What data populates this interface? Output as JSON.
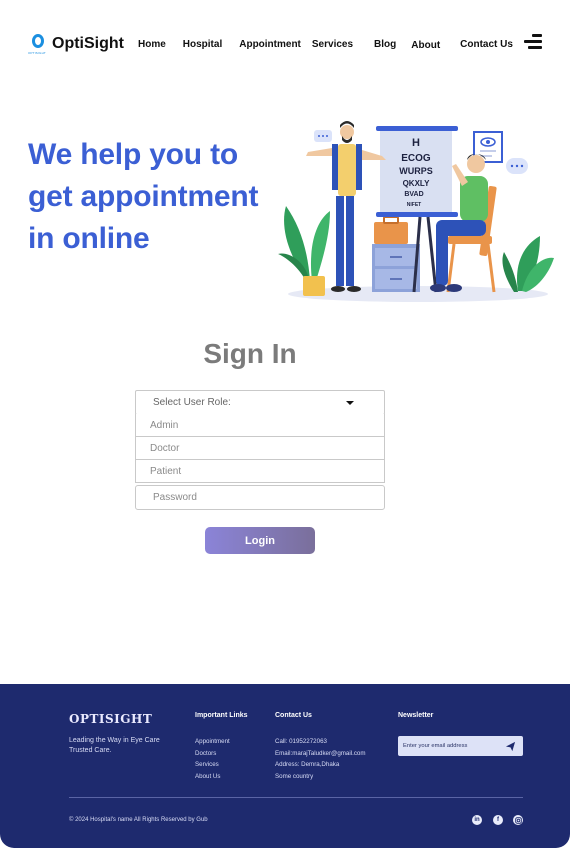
{
  "brand": {
    "logo_text": "OptiSight",
    "logo_small": "OPTISIGHT"
  },
  "nav": {
    "links": [
      "Home",
      "Hospital",
      "Appointment",
      "Services",
      "Blog",
      "About",
      "Contact Us"
    ]
  },
  "hero": {
    "title_line1": "We  help you  to",
    "title_line2": "get appointment",
    "title_line3": "in online",
    "eye_chart": [
      "H",
      "ECOG",
      "WURPS",
      "QKXLY",
      "BVAD",
      "NIFET"
    ]
  },
  "signin": {
    "title": "Sign In",
    "select_placeholder": "Select  User Role:",
    "options": [
      "Admin",
      "Doctor",
      "Patient"
    ],
    "password_placeholder": "Password",
    "login_label": "Login"
  },
  "footer": {
    "brand": "OPTISIGHT",
    "tagline": "Leading the Way in Eye Care Trusted Care.",
    "links_title": "Important Links",
    "links": [
      "Appointment",
      "Doctors",
      "Services",
      "About Us"
    ],
    "contact_title": "Contact Us",
    "contact": [
      "Call: 01952272063",
      "Email:marajTaludker@gmail.com",
      "Address: Demra,Dhaka",
      "Some country"
    ],
    "newsletter_title": "Newsletter",
    "newsletter_placeholder": "Enter your email address",
    "copyright": "© 2024 Hospital's name All Rights Reserved by Gub",
    "social": [
      "linkedin-icon",
      "facebook-icon",
      "instagram-icon"
    ]
  },
  "colors": {
    "accent": "#3b5fd4",
    "footer_bg": "#1e2a6e",
    "logo_blue": "#1b8fe0"
  }
}
